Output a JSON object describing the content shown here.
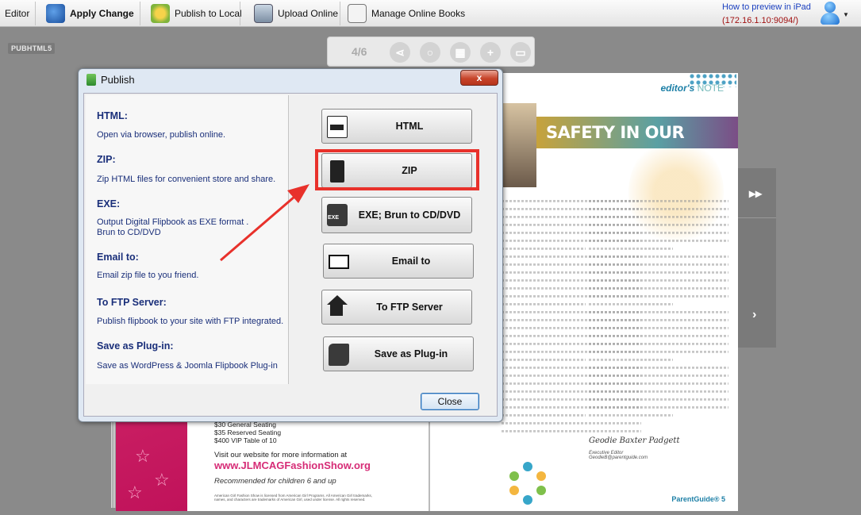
{
  "toolbar": {
    "editor_label": "Editor",
    "apply_label": "Apply Change",
    "publish_local_label": "Publish to Local",
    "upload_label": "Upload Online",
    "manage_label": "Manage Online Books",
    "preview_link": "How to preview in iPad",
    "preview_ip": "(172.16.1.10:9094/)"
  },
  "viewer": {
    "logo": "PUBHTML5",
    "page_indicator": "4/6"
  },
  "book": {
    "left": {
      "tickets": [
        "$30 General Seating",
        "$35 Reserved Seating",
        "$400 VIP Table of 10"
      ],
      "visit": "Visit our website for more information at",
      "url": "www.JLMCAGFashionShow.org",
      "recommend": "Recommended for children 6 and up",
      "fine_print": "American Girl Fashion Show is licensed from American Girl Programs. All American Girl trademarks, names, and characters are trademarks of American Girl, used under license. All rights reserved."
    },
    "right": {
      "editors_note_bold": "editor's",
      "editors_note_thin": "NOTE",
      "banner": "SAFETY IN OUR SCHOOLS",
      "signature": "Geodie Baxter Padgett",
      "sign_title": "Executive Editor",
      "sign_email": "GeodieB@parentguide.com",
      "footer": "ParentGuide®  5"
    }
  },
  "dialog": {
    "title": "Publish",
    "close_x": "x",
    "options": [
      {
        "heading": "HTML:",
        "desc": "Open via browser, publish online.",
        "button": "HTML"
      },
      {
        "heading": "ZIP:",
        "desc": "Zip HTML files for convenient store and share.",
        "button": "ZIP"
      },
      {
        "heading": "EXE:",
        "desc": "Output Digital Flipbook as EXE format . Brun to CD/DVD",
        "button": "EXE; Brun to CD/DVD"
      },
      {
        "heading": "Email to:",
        "desc": "Email zip file to you friend.",
        "button": "Email to"
      },
      {
        "heading": "To FTP Server:",
        "desc": "Publish flipbook to your site with FTP integrated.",
        "button": "To FTP Server"
      },
      {
        "heading": "Save as Plug-in:",
        "desc": "Save as WordPress & Joomla Flipbook Plug-in",
        "button": "Save as Plug-in"
      }
    ],
    "close_button": "Close"
  },
  "colors": {
    "highlight": "#e8312b",
    "label_blue": "#1a2f7a",
    "accent_pink": "#d62c76"
  }
}
